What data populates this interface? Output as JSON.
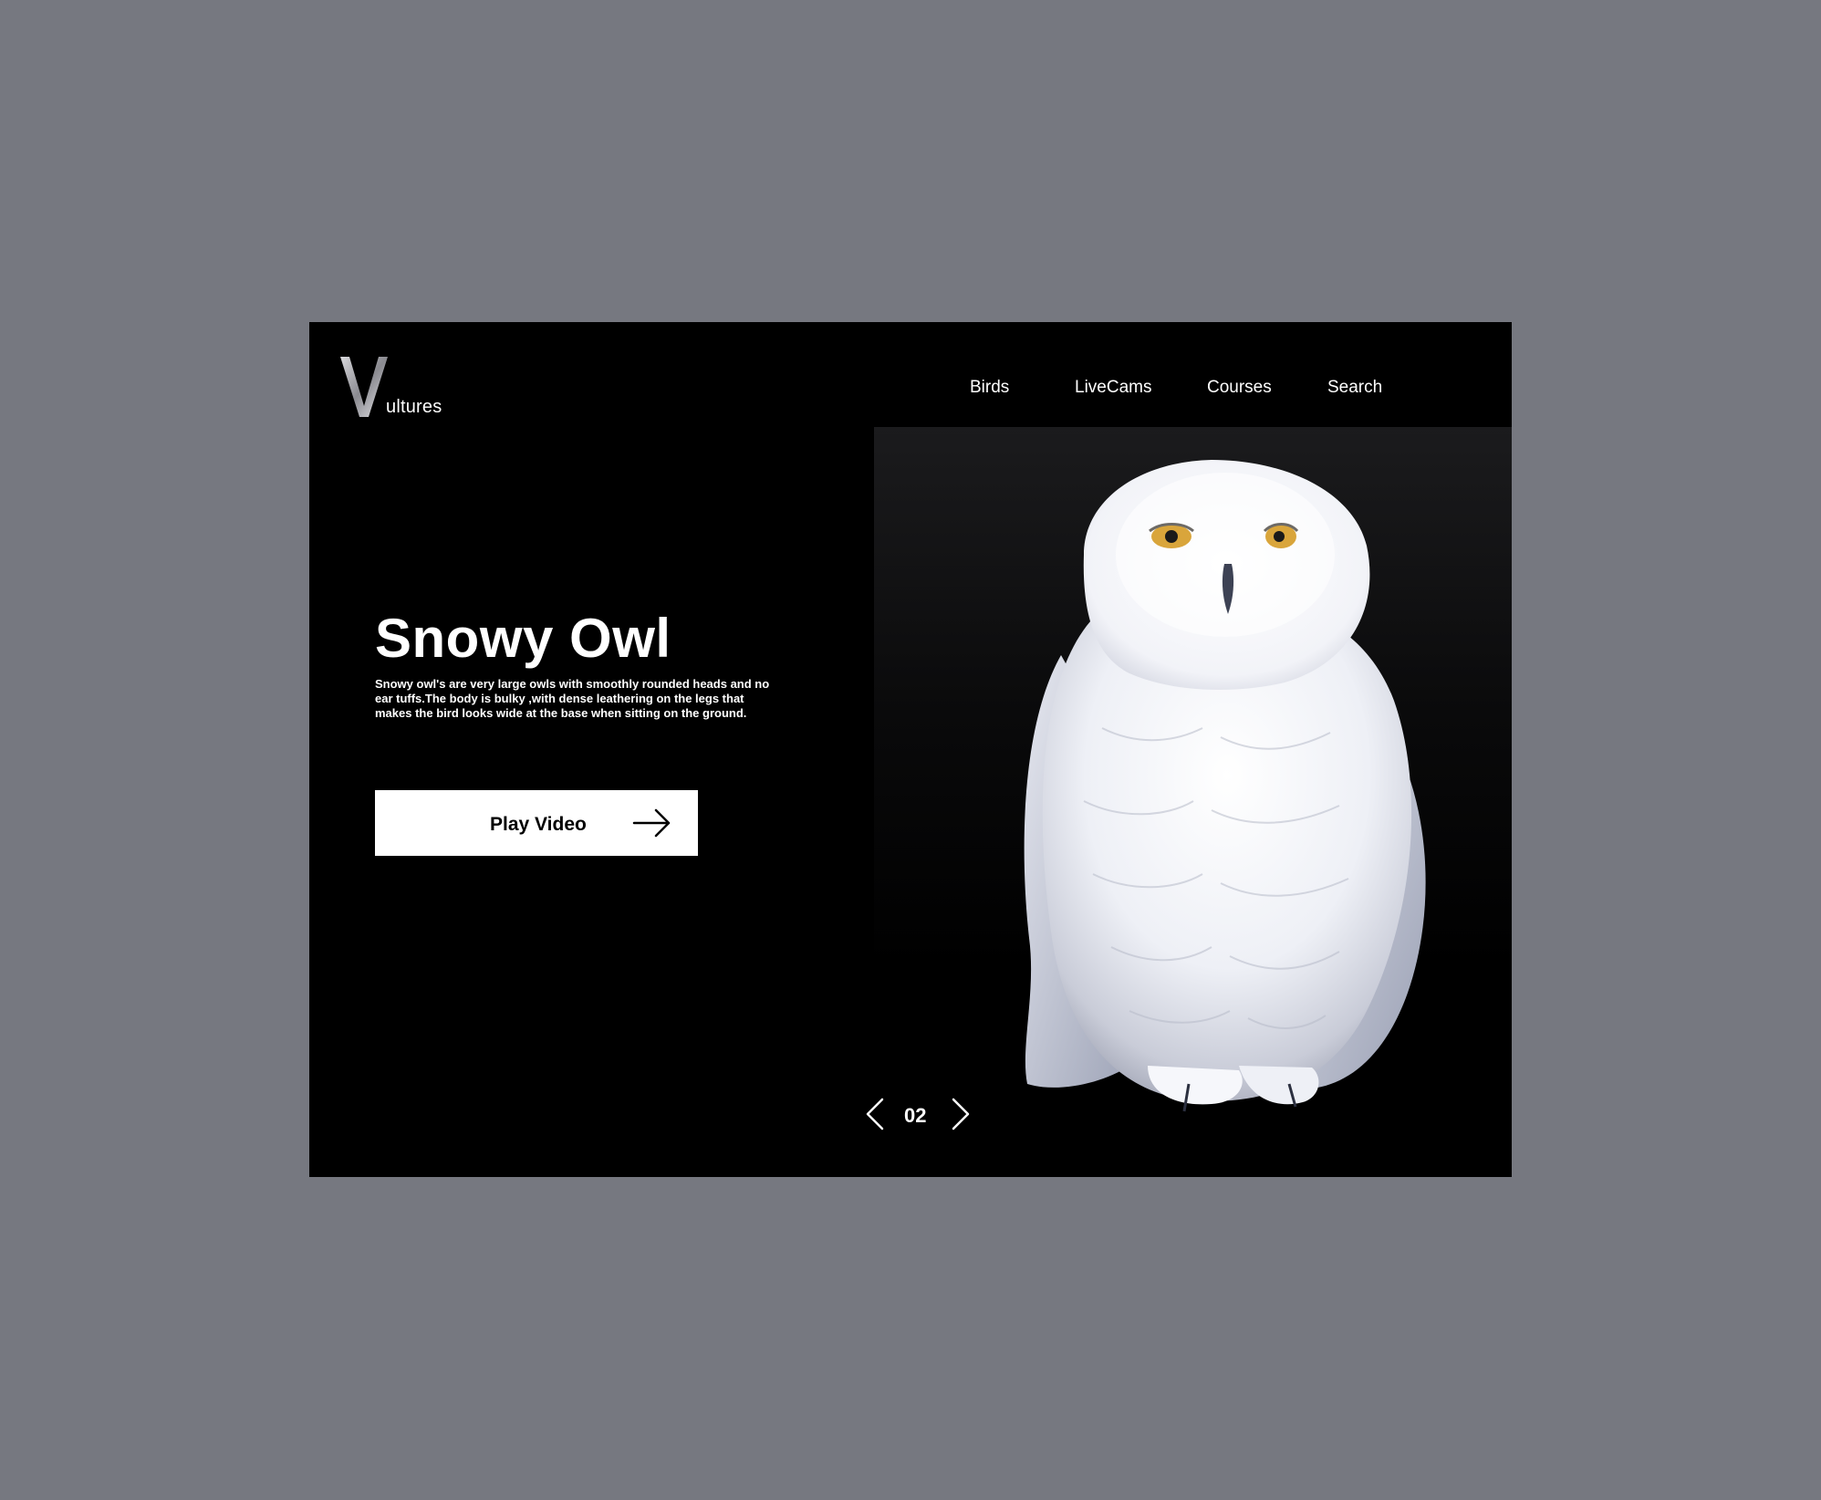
{
  "brand": {
    "logo_initial": "V",
    "logo_rest": "ultures"
  },
  "nav": {
    "items": [
      {
        "label": "Birds"
      },
      {
        "label": "LiveCams"
      },
      {
        "label": "Courses"
      },
      {
        "label": "Search"
      }
    ]
  },
  "hero": {
    "title": "Snowy Owl",
    "description": "Snowy owl's are very large owls with smoothly rounded heads and no ear tuffs.The body is bulky ,with dense leathering on the legs that makes the bird looks wide at the base when sitting on the ground.",
    "play_label": "Play Video",
    "image_subject": "snowy owl"
  },
  "pager": {
    "current": "02",
    "prev_icon": "chevron-left-icon",
    "next_icon": "chevron-right-icon"
  },
  "colors": {
    "page_background": "#767880",
    "frame_background": "#000000",
    "button_background": "#ffffff",
    "text_primary": "#ffffff",
    "owl_eye": "#d9a53b"
  }
}
